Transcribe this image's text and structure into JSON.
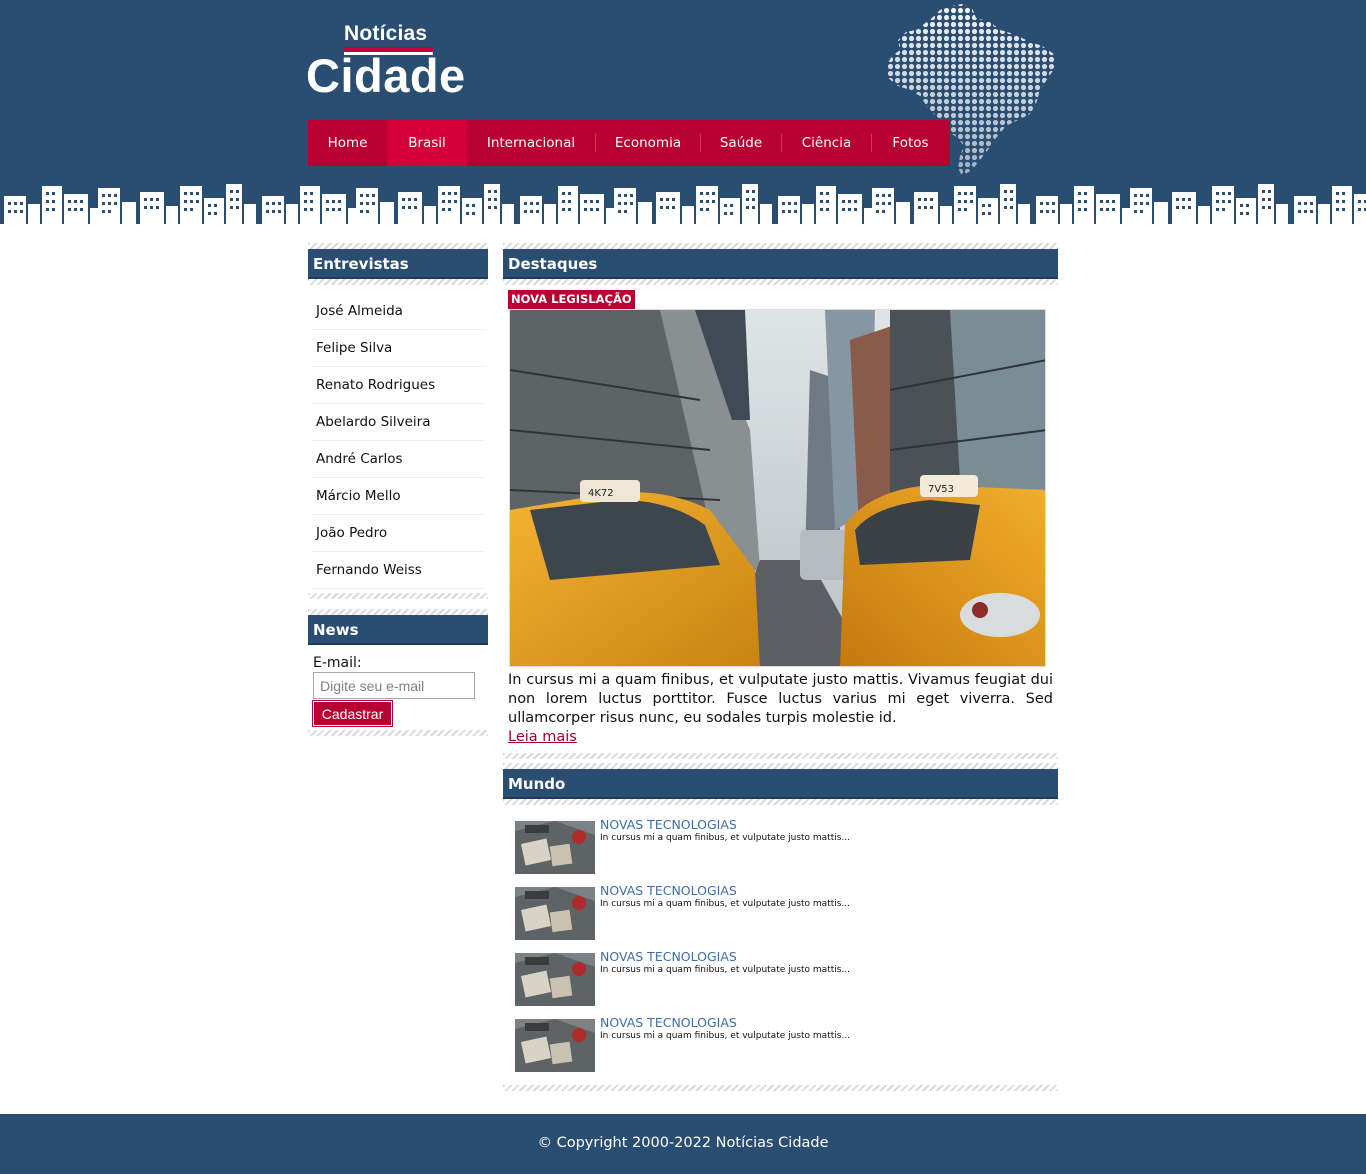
{
  "brand": {
    "top_word": "Notícias",
    "main_word": "Cidade",
    "colors": {
      "header": "#2a4d72",
      "accent": "#b80032",
      "accent_active": "#d60038",
      "link": "#3d6ea8"
    }
  },
  "nav": {
    "items": [
      {
        "label": "Home",
        "active": false
      },
      {
        "label": "Brasil",
        "active": true
      },
      {
        "label": "Internacional",
        "active": false
      },
      {
        "label": "Economia",
        "active": false
      },
      {
        "label": "Saúde",
        "active": false
      },
      {
        "label": "Ciência",
        "active": false
      },
      {
        "label": "Fotos",
        "active": false
      }
    ]
  },
  "sidebar": {
    "interviews": {
      "title": "Entrevistas",
      "items": [
        "José Almeida",
        "Felipe Silva",
        "Renato Rodrigues",
        "Abelardo Silveira",
        "André Carlos",
        "Márcio Mello",
        "João Pedro",
        "Fernando Weiss"
      ]
    },
    "news": {
      "title": "News",
      "email_label": "E-mail:",
      "email_placeholder": "Digite seu e-mail",
      "email_value": "",
      "button_label": "Cadastrar"
    }
  },
  "main": {
    "highlights": {
      "title": "Destaques",
      "tag": "NOVA LEGISLAÇÃO",
      "image_icon": "city-taxi-photo",
      "text": "In cursus mi a quam finibus, et vulputate justo mattis. Vivamus feugiat dui non lorem luctus porttitor. Fusce luctus varius mi eget viverra. Sed ullamcorper risus nunc, eu sodales turpis molestie id.",
      "read_more": "Leia mais"
    },
    "world": {
      "title": "Mundo",
      "items": [
        {
          "title": "NOVAS TECNOLOGIAS",
          "excerpt": "In cursus mi a quam finibus, et vulputate justo mattis..."
        },
        {
          "title": "NOVAS TECNOLOGIAS",
          "excerpt": "In cursus mi a quam finibus, et vulputate justo mattis..."
        },
        {
          "title": "NOVAS TECNOLOGIAS",
          "excerpt": "In cursus mi a quam finibus, et vulputate justo mattis..."
        },
        {
          "title": "NOVAS TECNOLOGIAS",
          "excerpt": "In cursus mi a quam finibus, et vulputate justo mattis..."
        }
      ]
    }
  },
  "footer": {
    "copyright": "© Copyright 2000-2022 Notícias Cidade"
  }
}
